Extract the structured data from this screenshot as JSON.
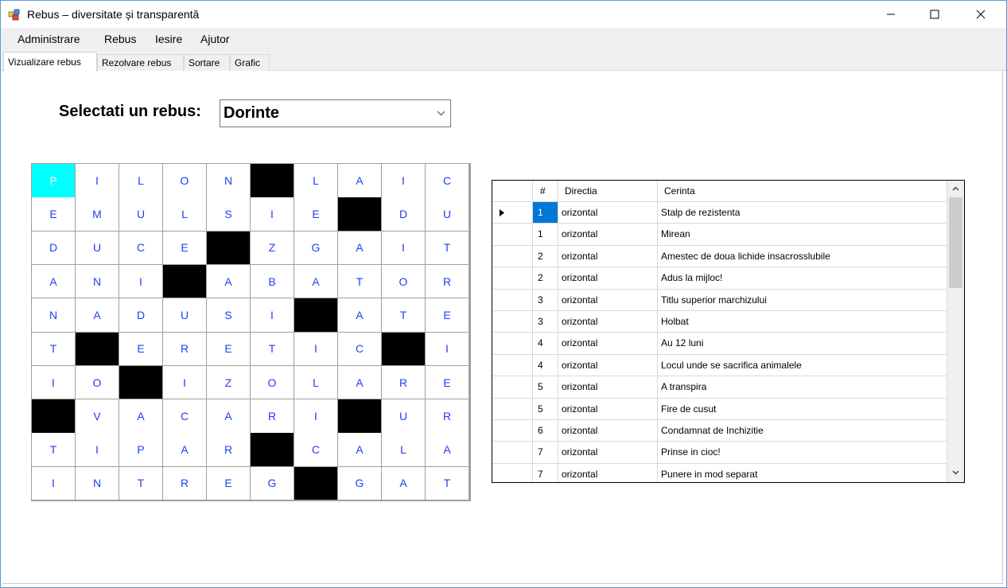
{
  "window": {
    "title": "Rebus – diversitate și transparentă"
  },
  "menu": [
    "Administrare",
    "Rebus",
    "Iesire",
    "Ajutor"
  ],
  "tabs": [
    {
      "label": "Vizualizare rebus",
      "active": true
    },
    {
      "label": "Rezolvare rebus",
      "active": false
    },
    {
      "label": "Sortare",
      "active": false
    },
    {
      "label": "Grafic",
      "active": false
    }
  ],
  "selector": {
    "label": "Selectati un rebus:",
    "value": "Dorinte"
  },
  "puzzle": {
    "rows": [
      [
        "P",
        "I",
        "L",
        "O",
        "N",
        "#",
        "L",
        "A",
        "I",
        "C"
      ],
      [
        "E",
        "M",
        "U",
        "L",
        "S",
        "I",
        "E",
        "#",
        "D",
        "U"
      ],
      [
        "D",
        "U",
        "C",
        "E",
        "#",
        "Z",
        "G",
        "A",
        "I",
        "T"
      ],
      [
        "A",
        "N",
        "I",
        "#",
        "A",
        "B",
        "A",
        "T",
        "O",
        "R"
      ],
      [
        "N",
        "A",
        "D",
        "U",
        "S",
        "I",
        "#",
        "A",
        "T",
        "E"
      ],
      [
        "T",
        "#",
        "E",
        "R",
        "E",
        "T",
        "I",
        "C",
        "#",
        "I"
      ],
      [
        "I",
        "O",
        "#",
        "I",
        "Z",
        "O",
        "L",
        "A",
        "R",
        "E"
      ],
      [
        "#",
        "V",
        "A",
        "C",
        "A",
        "R",
        "I",
        "#",
        "U",
        "R"
      ],
      [
        "T",
        "I",
        "P",
        "A",
        "R",
        "#",
        "C",
        "A",
        "L",
        "A"
      ],
      [
        "I",
        "N",
        "T",
        "R",
        "E",
        "G",
        "#",
        "G",
        "A",
        "T"
      ]
    ],
    "selected_cell": {
      "row": 0,
      "col": 0
    },
    "colors": {
      "letter": "#1f3ff3",
      "selected": "#00ffff",
      "black": "#000000"
    }
  },
  "table": {
    "columns": [
      "#",
      "Directia",
      "Cerinta"
    ],
    "rows": [
      {
        "num": "1",
        "dir": "orizontal",
        "text": "Stalp de rezistenta"
      },
      {
        "num": "1",
        "dir": "orizontal",
        "text": "Mirean"
      },
      {
        "num": "2",
        "dir": "orizontal",
        "text": "Amestec de doua lichide insacrosslubile"
      },
      {
        "num": "2",
        "dir": "orizontal",
        "text": "Adus la mijloc!"
      },
      {
        "num": "3",
        "dir": "orizontal",
        "text": "Titlu superior marchizului"
      },
      {
        "num": "3",
        "dir": "orizontal",
        "text": "Holbat"
      },
      {
        "num": "4",
        "dir": "orizontal",
        "text": "Au 12 luni"
      },
      {
        "num": "4",
        "dir": "orizontal",
        "text": "Locul unde se sacrifica animalele"
      },
      {
        "num": "5",
        "dir": "orizontal",
        "text": "A transpira"
      },
      {
        "num": "5",
        "dir": "orizontal",
        "text": "Fire de cusut"
      },
      {
        "num": "6",
        "dir": "orizontal",
        "text": "Condamnat de Inchizitie"
      },
      {
        "num": "7",
        "dir": "orizontal",
        "text": "Prinse in cioc!"
      },
      {
        "num": "7",
        "dir": "orizontal",
        "text": "Punere in mod separat"
      }
    ],
    "current_row": 0,
    "highlight_color": "#0078d7"
  }
}
